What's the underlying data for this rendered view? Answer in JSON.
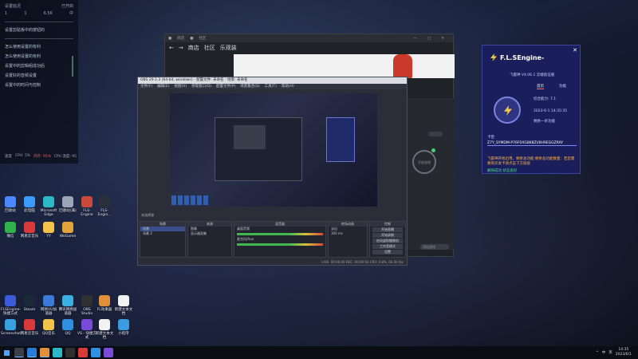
{
  "left_panel": {
    "header_left": "设置延迟",
    "header_right": "已开启",
    "row2": [
      "1",
      "1",
      "6.5K",
      "中"
    ],
    "tips": [
      "设置剪贴板中的按钮的",
      "怎么使用设置的有利",
      "怎么使用设置的有利",
      "设置中的剪辑组成功后",
      "设置好的音频设置",
      "设置中的时间与控制"
    ],
    "stats": [
      "速度",
      "CPU: 5%",
      "内存: 95%",
      "CPU 温度: 95"
    ]
  },
  "desktop_icons": [
    {
      "label": "回收站",
      "color": "#4b89ff"
    },
    {
      "label": "此电脑",
      "color": "#3a9bff"
    },
    {
      "label": "Microsoft Edge",
      "color": "#2cb8c6"
    },
    {
      "label": "回收站(满)",
      "color": "#9aa6b8"
    },
    {
      "label": "FLS-Engine",
      "color": "#c94a3a"
    },
    {
      "label": "FLS-Engin...",
      "color": "#2a2f3a"
    },
    {
      "label": "微信",
      "color": "#2fb34a"
    },
    {
      "label": "网易云音乐",
      "color": "#d83a3a"
    },
    {
      "label": "YY",
      "color": "#f2c24b"
    },
    {
      "label": "WeGame",
      "color": "#e0a43a"
    },
    {
      "label": "FLSEngine-快捷方式",
      "color": "#3b5bd8"
    },
    {
      "label": "Steam",
      "color": "#1b2838"
    },
    {
      "label": "网易UU加速器",
      "color": "#3a7bd8"
    },
    {
      "label": "腾讯网络加速器",
      "color": "#3ab0e0"
    },
    {
      "label": "OBS Studio",
      "color": "#303030"
    },
    {
      "label": "FL效果器",
      "color": "#e0903a"
    },
    {
      "label": "新建文本文档",
      "color": "#f2f2f2"
    },
    {
      "label": "Screenshot",
      "color": "#3aa0e0"
    },
    {
      "label": "网易云音乐",
      "color": "#d83a3a"
    },
    {
      "label": "QQ音乐",
      "color": "#f2c24b"
    },
    {
      "label": "QQ",
      "color": "#2f8fe0"
    },
    {
      "label": "VS - 快捷方式",
      "color": "#7a4ad8"
    },
    {
      "label": "新建文本文档",
      "color": "#f2f2f2"
    },
    {
      "label": "小程序",
      "color": "#3a9be0"
    }
  ],
  "browser": {
    "tab_items": [
      "■",
      "商店",
      "■",
      "社区",
      "■",
      "■",
      "■"
    ],
    "nav": [
      "←",
      "→",
      "商店",
      "社区",
      "乐观装"
    ],
    "side_label": "自定义",
    "ring_label": "开始游戏",
    "search_placeholder": "添加游戏"
  },
  "obs": {
    "title": "OBS 29.1.3 (64-bit, windows) - 配置文件: 未命名 - 场景: 未命名",
    "menu": [
      "文件(F)",
      "编辑(E)",
      "视图(V)",
      "停靠窗口(D)",
      "配置文件(P)",
      "场景集合(S)",
      "工具(T)",
      "帮助(H)"
    ],
    "preview_label": "未选择源",
    "dock_titles": [
      "场景",
      "来源",
      "混音器",
      "转场动画",
      "控制"
    ],
    "scenes": [
      "场景",
      "场景 2"
    ],
    "sources": [
      "图像",
      "显示器采集"
    ],
    "mixer": [
      "桌面音频",
      "麦克风/Aux",
      "0.0 dB",
      "0.0 dB"
    ],
    "transition": [
      "淡出",
      "时长",
      "300 ms"
    ],
    "controls": [
      "开始直播",
      "开始录制",
      "启动虚拟摄像机",
      "工作室模式",
      "设置",
      "退出"
    ],
    "status": "LIVE: 00:00:00   REC: 00:00:00   CPU: 0.8%, 60.00 fps"
  },
  "fls": {
    "brand": "F.L.SEngine-",
    "version": "飞雷神 V4.06.1 云端验证版",
    "tabs": [
      "首页",
      "功能"
    ],
    "score_label": "综合能力: 7.1",
    "date": "2023-6-1 14:35:35",
    "status": "剩余一条功能",
    "card_label": "卡密",
    "key": "Z7Y_SYMDM-P76F0XG8K8ZV8H9EGGZRAY",
    "warn": "飞雷神开始启用，剩余总功能 剩余总功能数量：若您需要购买发卡请点击下方链接",
    "ok": "解除成功 状态良好"
  },
  "taskbar": {
    "apps": [
      "#3a3f47",
      "#2a7bd8",
      "#e0903a",
      "#2cb8c6",
      "#303030",
      "#d83a3a",
      "#2f8fe0",
      "#7a4ad8"
    ],
    "tray": [
      "^",
      "中",
      "英"
    ],
    "time": "14:35",
    "date": "2023/6/1"
  }
}
